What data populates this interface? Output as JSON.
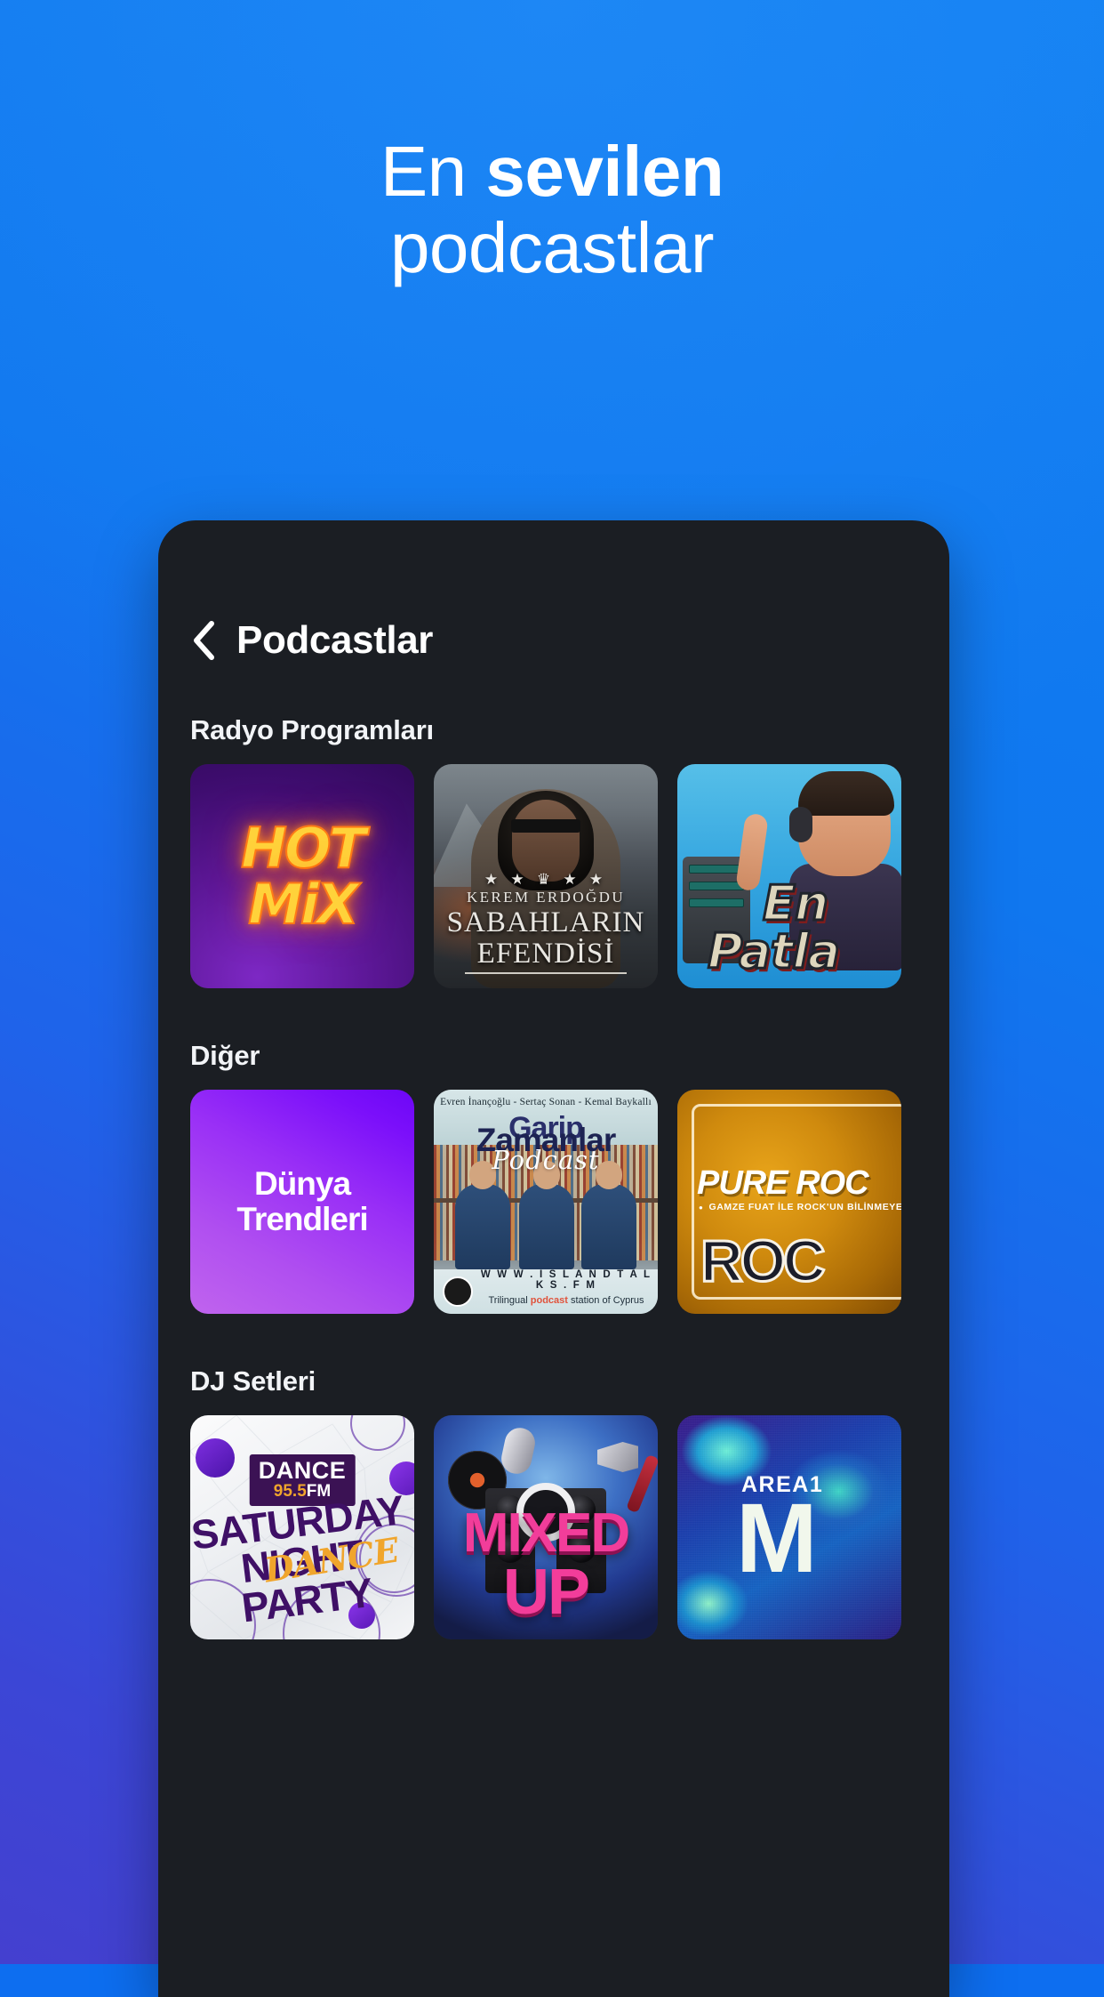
{
  "promo": {
    "headline_line1_regular": "En ",
    "headline_line1_bold": "sevilen",
    "headline_line2": "podcastlar",
    "background_color_top": "#1280f2",
    "background_color_bottom": "#4440cf"
  },
  "app": {
    "back_icon": "chevron-left-icon",
    "screen_title": "Podcastlar",
    "surface_color": "#1b1e23",
    "sections": [
      {
        "title": "Radyo Programları",
        "tiles": [
          {
            "name": "hot-mix",
            "line1": "HOT",
            "line2": "MiX"
          },
          {
            "name": "sabahlarin-efendisi",
            "crown": "★ ★ ♛ ★ ★",
            "host": "KEREM ERDOĞDU",
            "title_line1": "SABAHLARIN",
            "title_line2": "EFENDİSİ"
          },
          {
            "name": "en-patlayan",
            "line1": "En",
            "line2": "Patla"
          }
        ]
      },
      {
        "title": "Diğer",
        "tiles": [
          {
            "name": "dunya-trendleri",
            "line1": "Dünya",
            "line2": "Trendleri"
          },
          {
            "name": "garip-zamanlar",
            "hosts": "Evren İnançoğlu  -  Sertaç Sonan  -  Kemal Baykallı",
            "title_line1": "Garip",
            "title_line2": "Zamanlar",
            "subtitle": "Podcast",
            "url": "W W W . I S L A N D T A L K S . F M",
            "tagline_before": "Trilingual ",
            "tagline_accent": "podcast",
            "tagline_after": " station of Cyprus"
          },
          {
            "name": "pure-rock",
            "title": "PURE ROC",
            "subtitle": "GAMZE FUAT İLE ROCK'UN BİLİNMEYEN",
            "big": "ROC"
          }
        ]
      },
      {
        "title": "DJ Setleri",
        "tiles": [
          {
            "name": "saturday-night-dance-party",
            "logo_line1": "DANCE",
            "logo_number": "95.5",
            "logo_fm": "FM",
            "line1": "SATURDAY",
            "line2": "NIGHT",
            "line3": "PARTY",
            "script": "DANCE"
          },
          {
            "name": "mixed-up",
            "line1": "MIXED",
            "line2": "UP"
          },
          {
            "name": "area10",
            "line1": "AREA1",
            "line2": "M"
          }
        ]
      }
    ]
  }
}
